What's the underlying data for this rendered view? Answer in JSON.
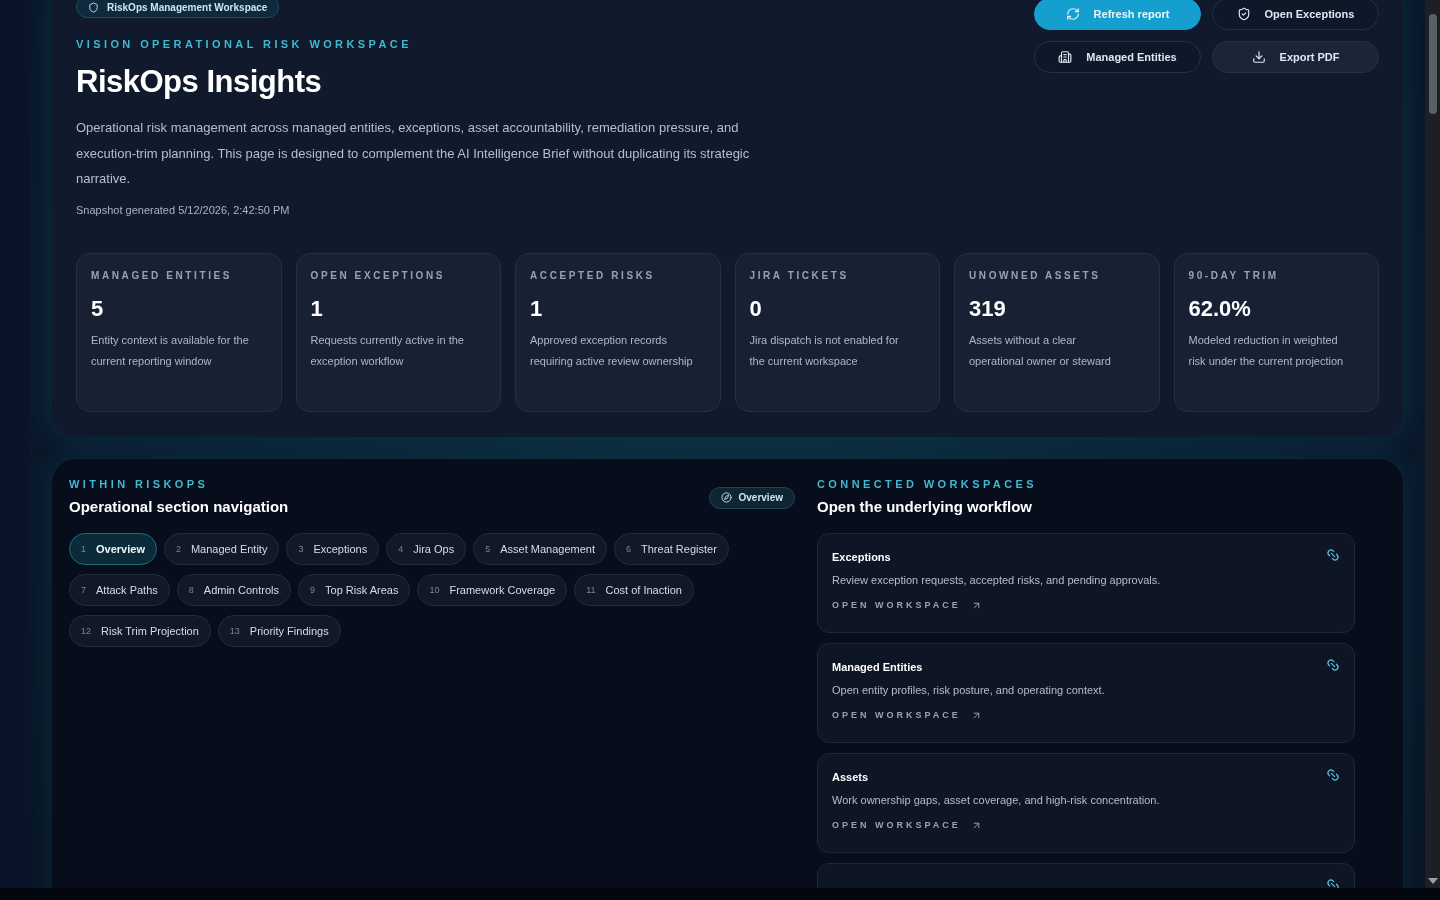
{
  "header": {
    "badge": "RiskOps Management Workspace",
    "eyebrow": "VISION OPERATIONAL RISK WORKSPACE",
    "title": "RiskOps Insights",
    "description": "Operational risk management across managed entities, exceptions, asset accountability, remediation pressure, and execution-trim planning. This page is designed to complement the AI Intelligence Brief without duplicating its strategic narrative.",
    "snapshot": "Snapshot generated 5/12/2026, 2:42:50 PM"
  },
  "actions": [
    {
      "label": "Refresh report",
      "kind": "primary"
    },
    {
      "label": "Open Exceptions",
      "kind": "secondary"
    },
    {
      "label": "Managed Entities",
      "kind": "secondary"
    },
    {
      "label": "Export PDF",
      "kind": "muted"
    }
  ],
  "stats": [
    {
      "label": "MANAGED ENTITIES",
      "value": "5",
      "note": "Entity context is available for the current reporting window"
    },
    {
      "label": "OPEN EXCEPTIONS",
      "value": "1",
      "note": "Requests currently active in the exception workflow"
    },
    {
      "label": "ACCEPTED RISKS",
      "value": "1",
      "note": "Approved exception records requiring active review ownership"
    },
    {
      "label": "JIRA TICKETS",
      "value": "0",
      "note": "Jira dispatch is not enabled for the current workspace"
    },
    {
      "label": "UNOWNED ASSETS",
      "value": "319",
      "note": "Assets without a clear operational owner or steward"
    },
    {
      "label": "90-DAY TRIM",
      "value": "62.0%",
      "note": "Modeled reduction in weighted risk under the current projection"
    }
  ],
  "section_nav": {
    "eyebrow": "WITHIN RISKOPS",
    "title": "Operational section navigation",
    "chip": "Overview",
    "items": [
      {
        "number": "1",
        "label": "Overview",
        "selected": true
      },
      {
        "number": "2",
        "label": "Managed Entity",
        "selected": false
      },
      {
        "number": "3",
        "label": "Exceptions",
        "selected": false
      },
      {
        "number": "4",
        "label": "Jira Ops",
        "selected": false
      },
      {
        "number": "5",
        "label": "Asset Management",
        "selected": false
      },
      {
        "number": "6",
        "label": "Threat Register",
        "selected": false
      },
      {
        "number": "7",
        "label": "Attack Paths",
        "selected": false
      },
      {
        "number": "8",
        "label": "Admin Controls",
        "selected": false
      },
      {
        "number": "9",
        "label": "Top Risk Areas",
        "selected": false
      },
      {
        "number": "10",
        "label": "Framework Coverage",
        "selected": false
      },
      {
        "number": "11",
        "label": "Cost of Inaction",
        "selected": false
      },
      {
        "number": "12",
        "label": "Risk Trim Projection",
        "selected": false
      },
      {
        "number": "13",
        "label": "Priority Findings",
        "selected": false
      }
    ]
  },
  "workspaces": {
    "eyebrow": "CONNECTED WORKSPACES",
    "title": "Open the underlying workflow",
    "cards": [
      {
        "title": "Exceptions",
        "description": "Review exception requests, accepted risks, and pending approvals.",
        "link": "OPEN WORKSPACE"
      },
      {
        "title": "Managed Entities",
        "description": "Open entity profiles, risk posture, and operating context.",
        "link": "OPEN WORKSPACE"
      },
      {
        "title": "Assets",
        "description": "Work ownership gaps, asset coverage, and high-risk concentration.",
        "link": "OPEN WORKSPACE"
      }
    ]
  }
}
